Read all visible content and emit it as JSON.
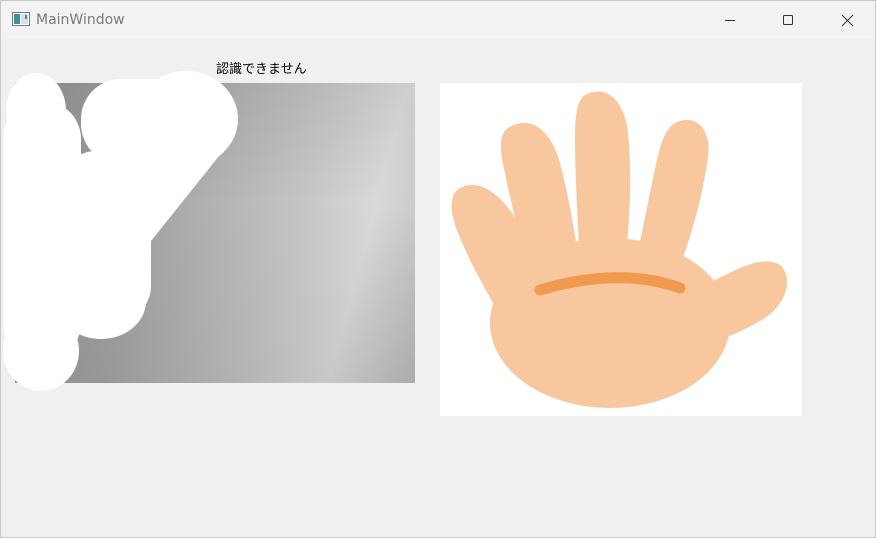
{
  "window": {
    "title": "MainWindow",
    "app_icon": "window-app-icon",
    "controls": {
      "minimize_icon": "minimize-icon",
      "maximize_icon": "maximize-icon",
      "close_icon": "close-icon"
    }
  },
  "main": {
    "status_text": "認識できません",
    "camera_view": {
      "content": "webcam-feed"
    },
    "hand_image": {
      "content": "open-hand-illustration",
      "skin_color": "#f8c79e",
      "line_color": "#ef9a4e"
    }
  }
}
